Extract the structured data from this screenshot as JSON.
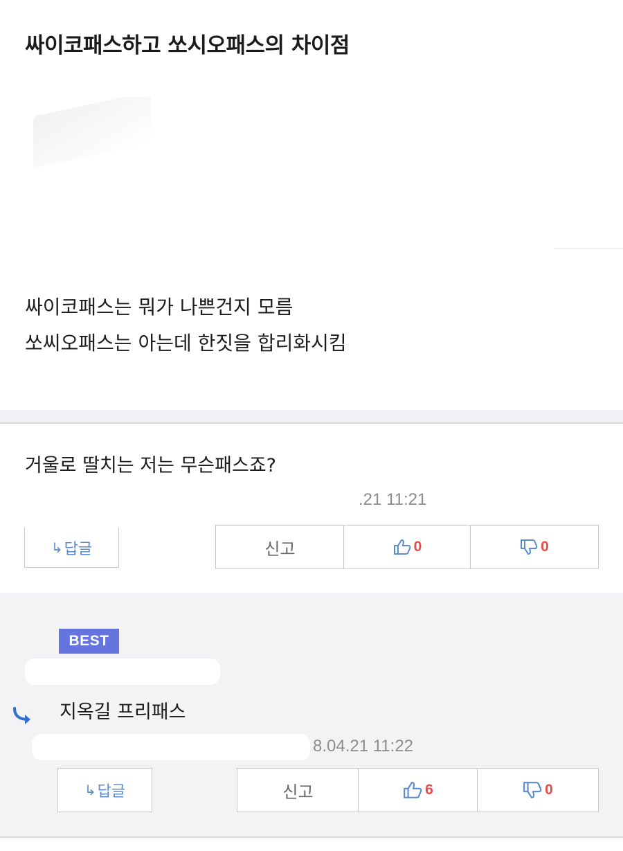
{
  "post": {
    "title": "싸이코패스하고 쏘시오패스의 차이점",
    "body": [
      "싸이코패스는 뭐가 나쁜건지 모름",
      "쏘씨오패스는 아는데 한짓을 합리화시킴"
    ]
  },
  "comments": [
    {
      "text": "거울로 딸치는 저는 무슨패스죠?",
      "timestamp": ".21 11:21",
      "reply_label": "답글",
      "report_label": "신고",
      "likes": "0",
      "dislikes": "0"
    },
    {
      "badge": "BEST",
      "text": "지옥길 프리패스",
      "timestamp": "8.04.21 11:22",
      "reply_label": "답글",
      "report_label": "신고",
      "likes": "6",
      "dislikes": "0"
    }
  ],
  "colors": {
    "accent": "#6674e0",
    "like_count": "#e64b4b",
    "link_blue": "#5b8bd0"
  }
}
